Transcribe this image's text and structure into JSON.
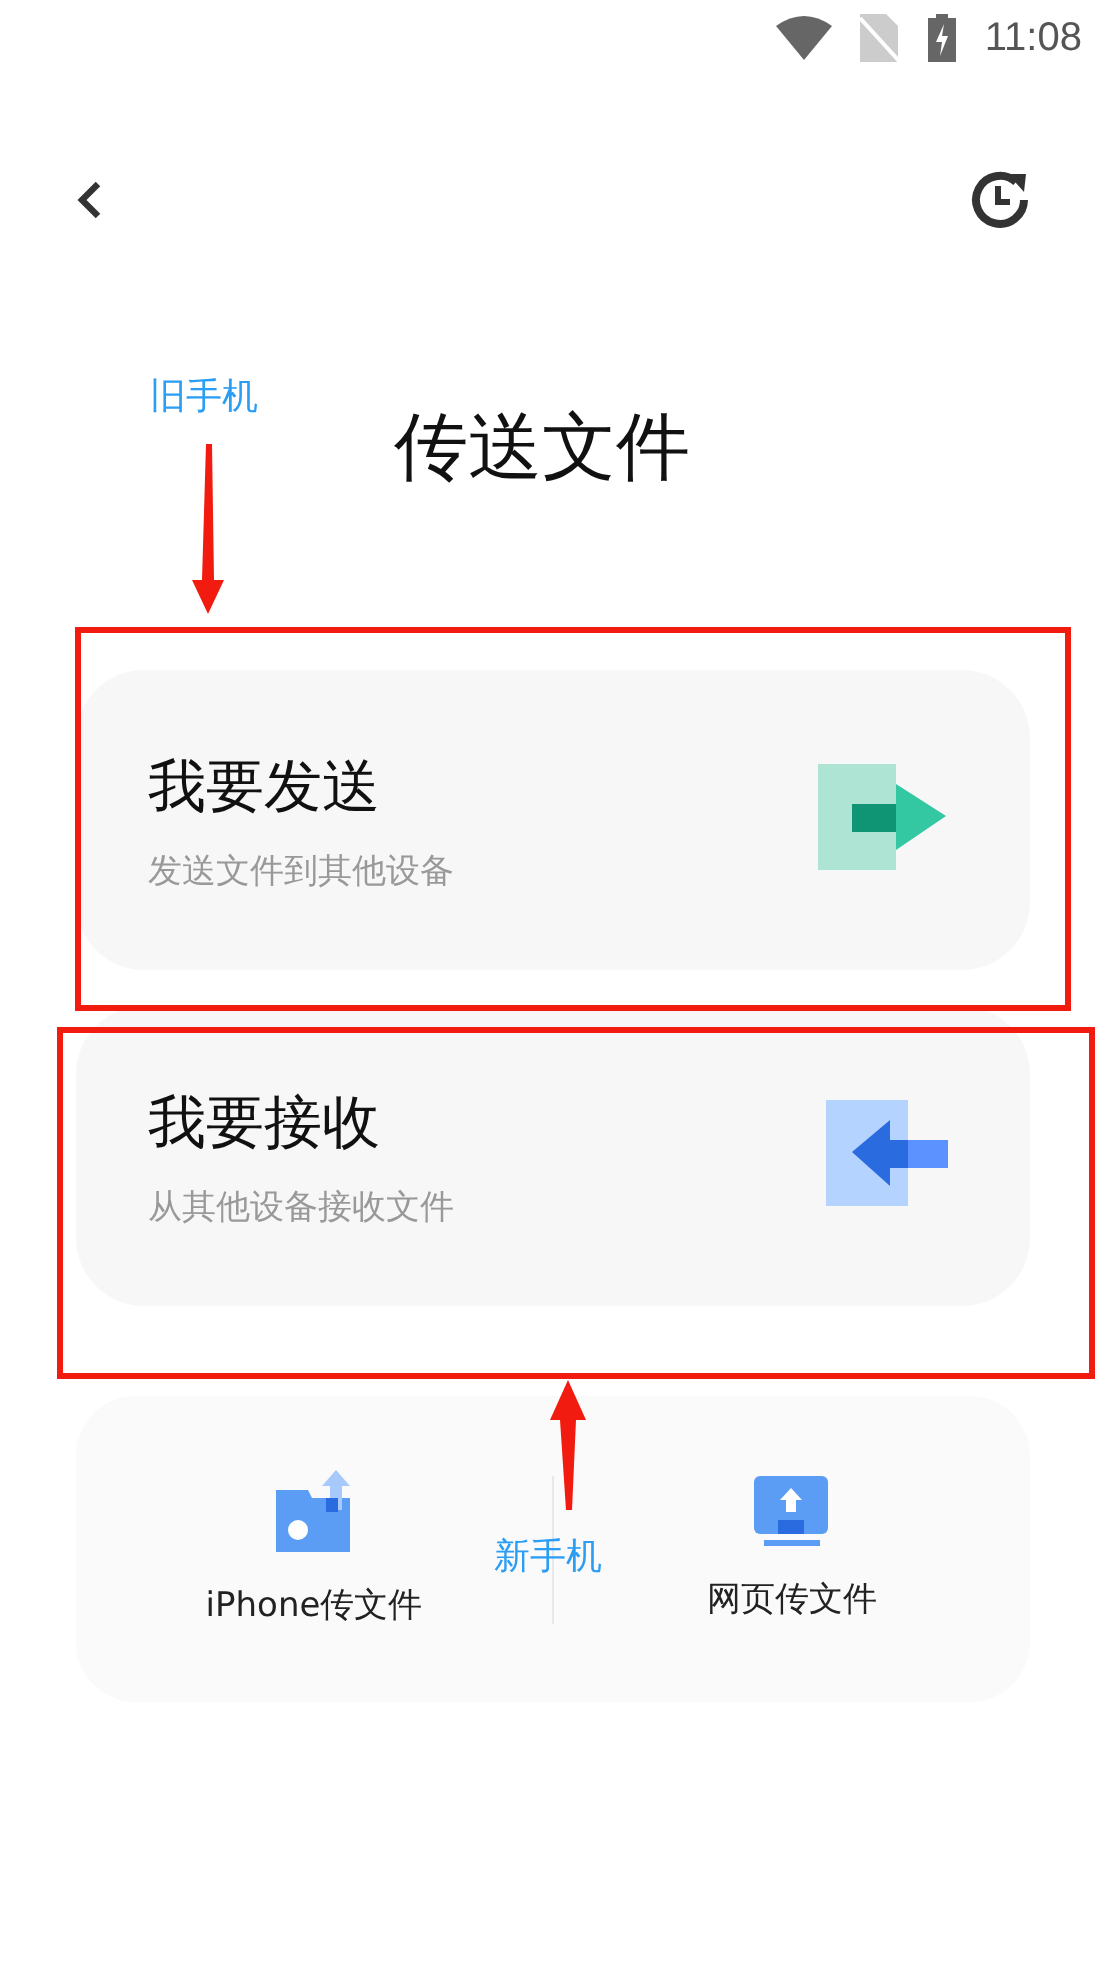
{
  "status_bar": {
    "time": "11:08"
  },
  "title": "传送文件",
  "options": [
    {
      "kind": "send",
      "title": "我要发送",
      "subtitle": "发送文件到其他设备"
    },
    {
      "kind": "receive",
      "title": "我要接收",
      "subtitle": "从其他设备接收文件"
    }
  ],
  "extra_actions": [
    {
      "kind": "iphone",
      "label": "iPhone传文件"
    },
    {
      "kind": "web",
      "label": "网页传文件"
    }
  ],
  "annotations": [
    {
      "label": "旧手机"
    },
    {
      "label": "新手机"
    }
  ]
}
